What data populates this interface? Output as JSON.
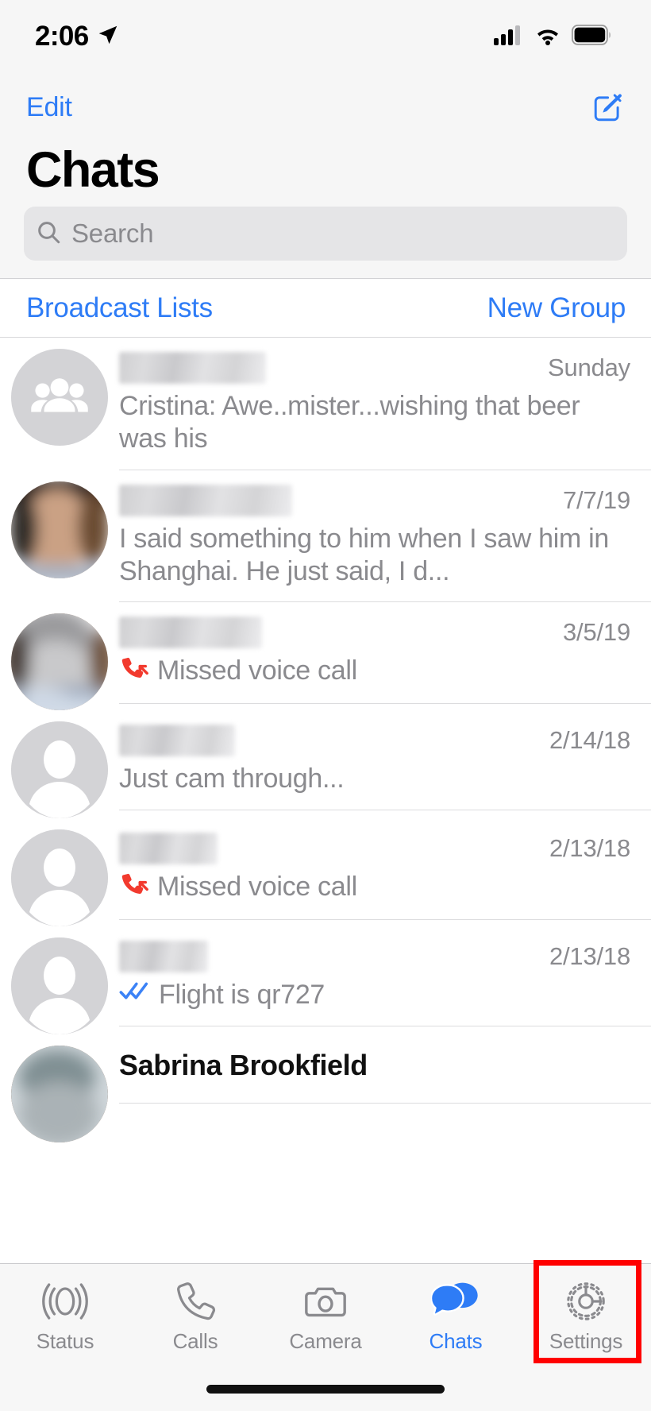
{
  "status_bar": {
    "time": "2:06",
    "location_icon": "location-arrow-icon",
    "cellular_icon": "cellular-signal-icon",
    "wifi_icon": "wifi-icon",
    "battery_icon": "battery-full-icon"
  },
  "header": {
    "edit_label": "Edit",
    "compose_icon": "compose-new-message-icon",
    "title": "Chats",
    "search": {
      "placeholder": "Search",
      "value": "",
      "icon": "search-icon"
    }
  },
  "actions": {
    "broadcast_label": "Broadcast Lists",
    "new_group_label": "New Group"
  },
  "chats": [
    {
      "name": "",
      "name_redacted": true,
      "avatar": "group-avatar-icon",
      "time": "Sunday",
      "message": "Cristina: Awe..mister...wishing that beer was his",
      "status_icon": ""
    },
    {
      "name": "",
      "name_redacted": true,
      "avatar": "photo-avatar-blurred",
      "time": "7/7/19",
      "message": "I said something to him when I saw him in Shanghai. He just said, I d...",
      "status_icon": ""
    },
    {
      "name": "",
      "name_redacted": true,
      "avatar": "photo-avatar-blurred",
      "time": "3/5/19",
      "message": "Missed voice call",
      "status_icon": "missed-voice-call-icon"
    },
    {
      "name": "",
      "name_redacted": true,
      "avatar": "default-person-avatar-icon",
      "time": "2/14/18",
      "message": "Just cam through...",
      "status_icon": ""
    },
    {
      "name": "",
      "name_redacted": true,
      "avatar": "default-person-avatar-icon",
      "time": "2/13/18",
      "message": "Missed voice call",
      "status_icon": "missed-voice-call-icon"
    },
    {
      "name": "",
      "name_redacted": true,
      "avatar": "default-person-avatar-icon",
      "time": "2/13/18",
      "message": "Flight is qr727",
      "status_icon": "read-receipt-double-check-icon"
    },
    {
      "name": "Sabrina Brookfield",
      "name_redacted": false,
      "avatar": "photo-avatar-blurred",
      "time": "",
      "message": "",
      "status_icon": ""
    }
  ],
  "tab_bar": {
    "tabs": [
      {
        "label": "Status",
        "icon": "status-rings-icon",
        "active": false
      },
      {
        "label": "Calls",
        "icon": "phone-handset-icon",
        "active": false
      },
      {
        "label": "Camera",
        "icon": "camera-icon",
        "active": false
      },
      {
        "label": "Chats",
        "icon": "chat-bubbles-icon",
        "active": true
      },
      {
        "label": "Settings",
        "icon": "gear-icon",
        "active": false
      }
    ]
  },
  "annotation": {
    "highlight_target": "Settings",
    "highlight_color": "#FF0000"
  },
  "colors": {
    "accent_blue": "#2E7CF6",
    "missed_call_red": "#F23A2E",
    "read_check_blue": "#3B82F6",
    "secondary_text": "#8A8A8E",
    "header_bg": "#F6F6F6"
  }
}
